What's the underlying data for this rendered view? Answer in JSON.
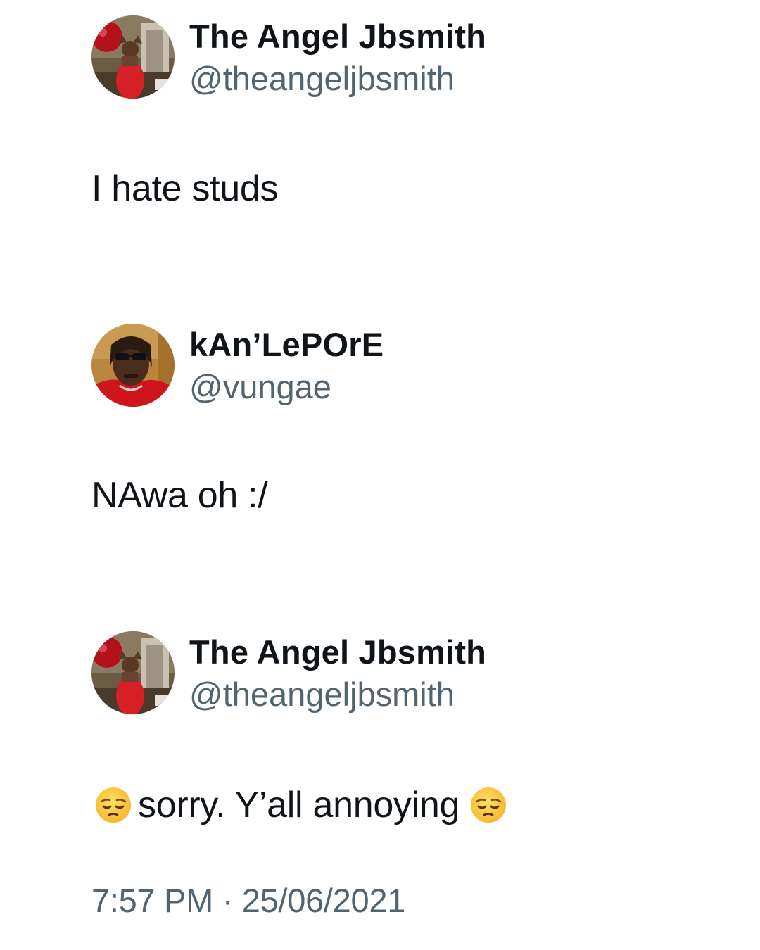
{
  "posts": [
    {
      "display_name": "The Angel Jbsmith",
      "handle": "@theangeljbsmith",
      "text": "I hate studs",
      "avatar": "profile-photo-woman-red-balloon"
    },
    {
      "display_name": "kAn’LePOrE",
      "handle": "@vungae",
      "text": "NAwa oh :/",
      "avatar": "profile-photo-person-sunglasses"
    },
    {
      "display_name": "The Angel Jbsmith",
      "handle": "@theangeljbsmith",
      "text": "sorry. Y’all annoying",
      "emoji": "pensive-face-icon",
      "avatar": "profile-photo-woman-red-balloon"
    }
  ],
  "timestamp": "7:57 PM · 25/06/2021",
  "colors": {
    "text": "#0f1419",
    "secondary": "#536471",
    "background": "#ffffff"
  }
}
